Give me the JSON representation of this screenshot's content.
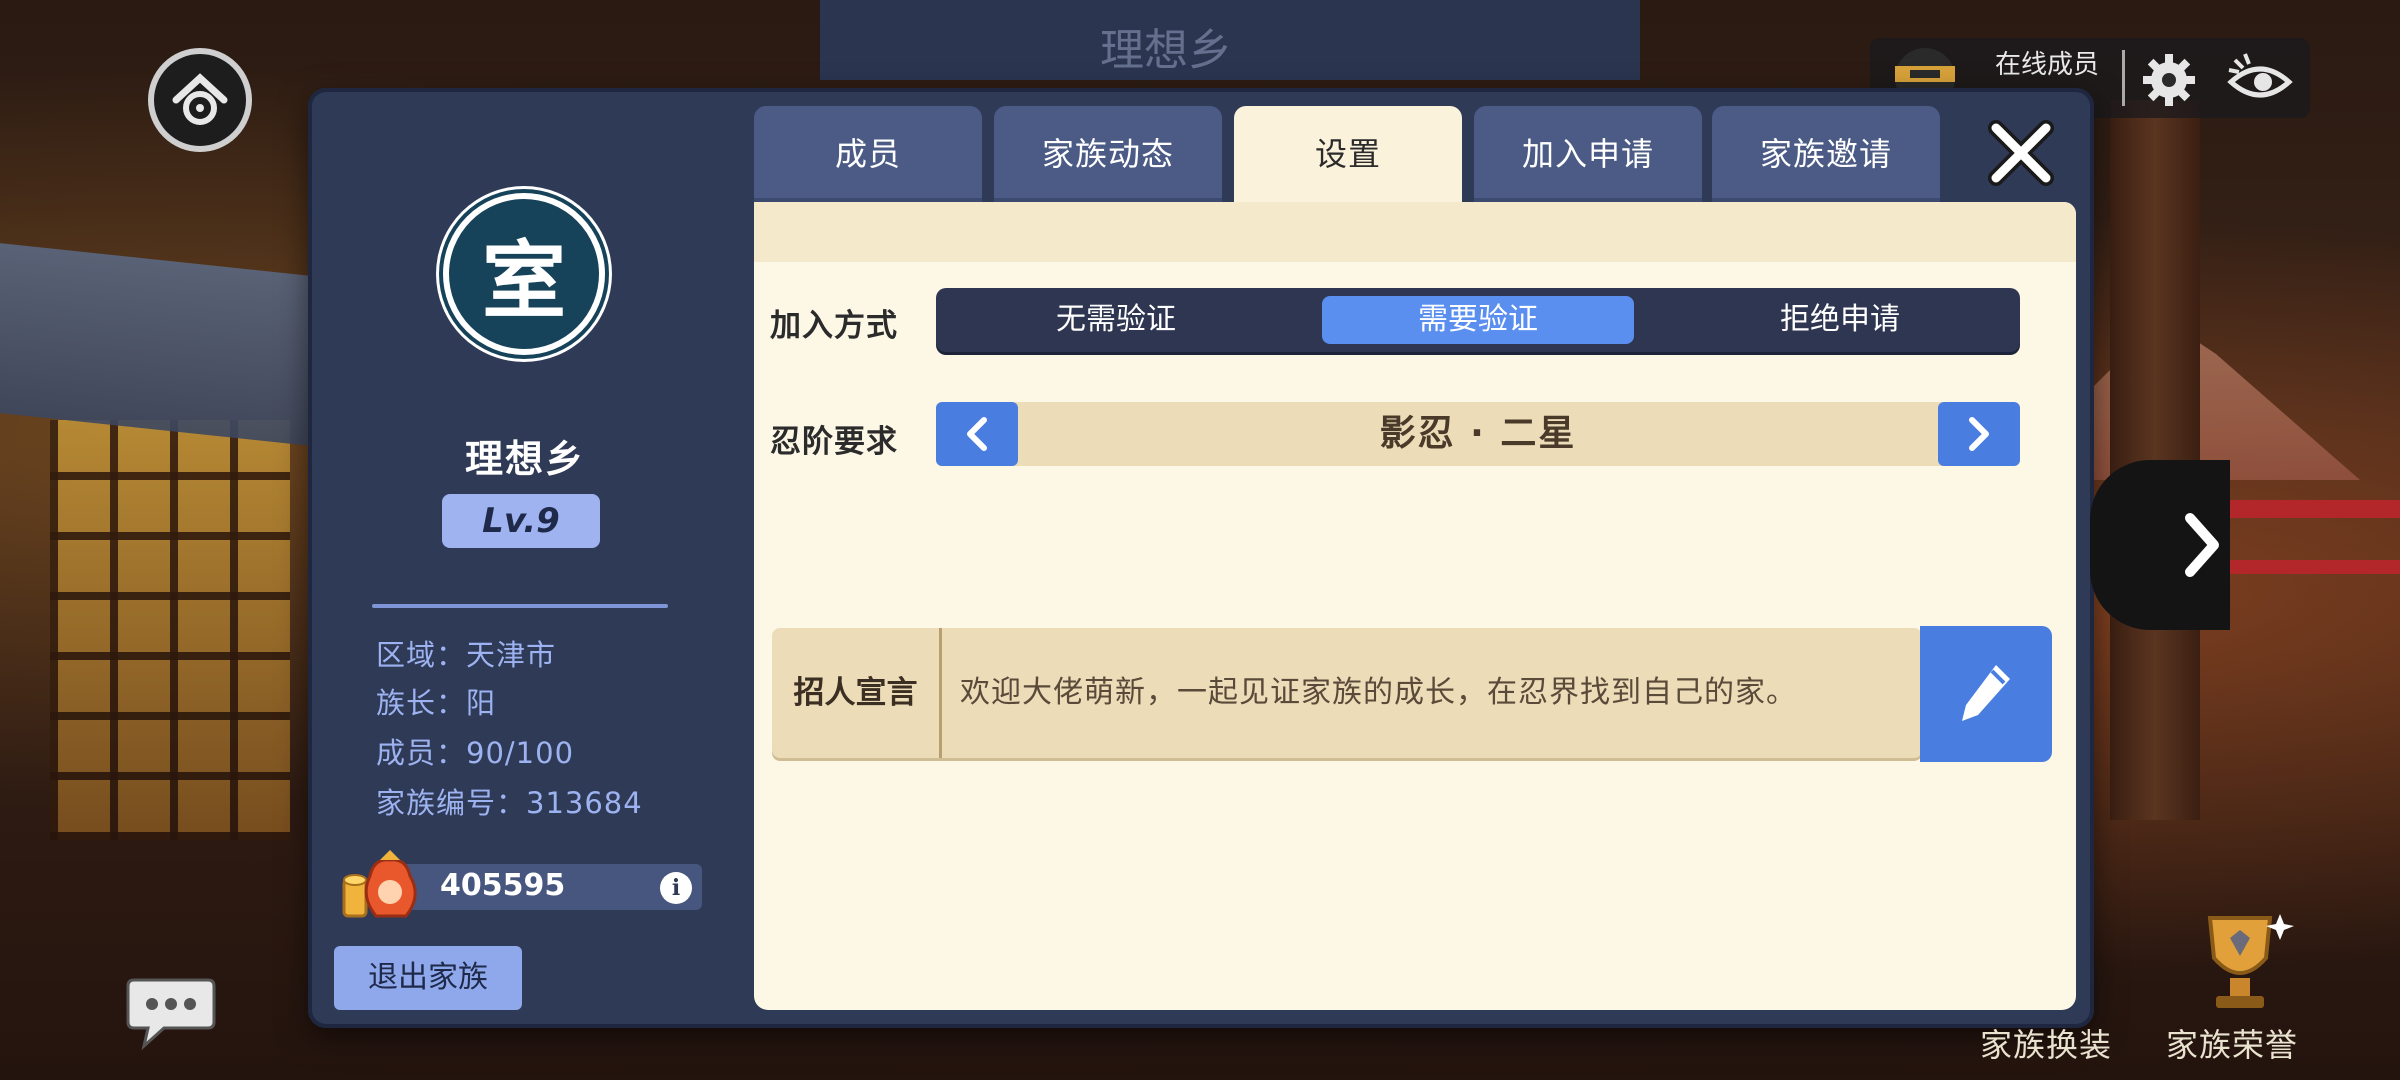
{
  "background": {
    "top_banner_text": "理想乡"
  },
  "top_bar": {
    "online_label": "在线成员",
    "icons": [
      "home-icon",
      "ninja-avatar-icon",
      "gear-icon",
      "eye-icon"
    ]
  },
  "family": {
    "emblem_char": "室",
    "name": "理想乡",
    "level": "Lv.9",
    "region": "区域：天津市",
    "leader": "族长：阳",
    "members": "成员：90/100",
    "family_id": "家族编号：313684",
    "funds": "405595",
    "info_symbol": "i",
    "leave_button": "退出家族"
  },
  "tabs": [
    {
      "label": "成员",
      "active": false
    },
    {
      "label": "家族动态",
      "active": false
    },
    {
      "label": "设置",
      "active": true
    },
    {
      "label": "加入申请",
      "active": false
    },
    {
      "label": "家族邀请",
      "active": false
    }
  ],
  "settings": {
    "join_method_label": "加入方式",
    "join_options": [
      {
        "label": "无需验证",
        "selected": false
      },
      {
        "label": "需要验证",
        "selected": true
      },
      {
        "label": "拒绝申请",
        "selected": false
      }
    ],
    "rank_label": "忍阶要求",
    "rank_value": "影忍 · 二星",
    "recruit_label": "招人宣言",
    "recruit_text": "欢迎大佬萌新，一起见证家族的成长，在忍界找到自己的家。"
  },
  "bottom_right": {
    "family_outfit": "家族换装",
    "family_honor": "家族荣誉"
  },
  "colors": {
    "panel": "#2f3a57",
    "content_bg": "#fdf8e6",
    "accent_blue": "#4a7de0",
    "selected_blue": "#5a8ff0",
    "tab_inactive": "#4b5b85",
    "info_text": "#9db2f0"
  }
}
